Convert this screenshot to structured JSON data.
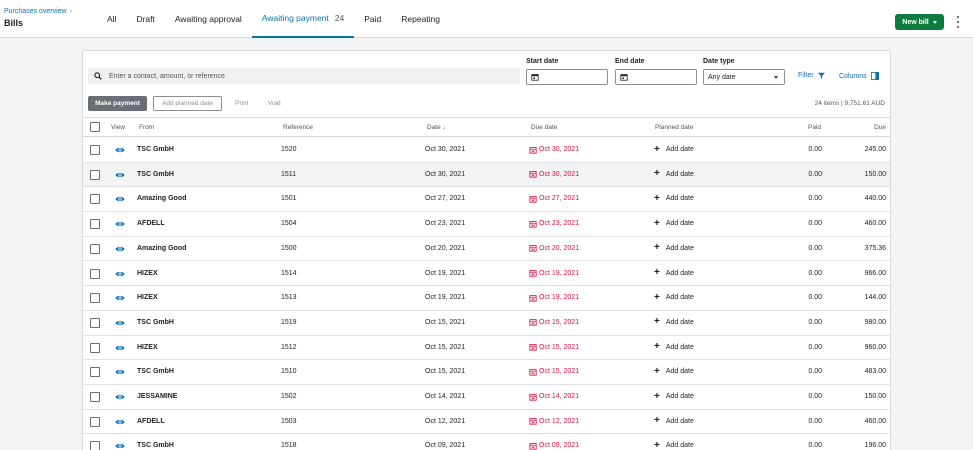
{
  "header": {
    "breadcrumb": "Purchases overview",
    "breadcrumb_chevron": "›",
    "title": "Bills",
    "new_bill_label": "New bill"
  },
  "tabs": [
    {
      "label": "All",
      "count": ""
    },
    {
      "label": "Draft",
      "count": ""
    },
    {
      "label": "Awaiting approval",
      "count": ""
    },
    {
      "label": "Awaiting payment",
      "count": "24",
      "active": true
    },
    {
      "label": "Paid",
      "count": ""
    },
    {
      "label": "Repeating",
      "count": ""
    }
  ],
  "filters": {
    "search_placeholder": "Enter a contact, amount, or reference",
    "start_date_label": "Start date",
    "end_date_label": "End date",
    "date_type_label": "Date type",
    "date_type_value": "Any date",
    "filter_label": "Filter",
    "columns_label": "Columns"
  },
  "actions": {
    "make_payment": "Make payment",
    "add_planned_date": "Add planned date",
    "print": "Print",
    "void": "Void",
    "summary": "24 items | 9,751.61 AUD"
  },
  "table": {
    "headers": {
      "view": "View",
      "from": "From",
      "reference": "Reference",
      "date": "Date",
      "date_sort": "↓",
      "due_date": "Due date",
      "planned_date": "Planned date",
      "paid": "Paid",
      "due": "Due"
    },
    "add_date_label": "Add date",
    "rows": [
      {
        "from": "TSC GmbH",
        "reference": "1520",
        "date": "Oct 30, 2021",
        "due_date": "Oct 30, 2021",
        "paid": "0.00",
        "due": "245.00"
      },
      {
        "from": "TSC GmbH",
        "reference": "1511",
        "date": "Oct 30, 2021",
        "due_date": "Oct 30, 2021",
        "paid": "0.00",
        "due": "150.00"
      },
      {
        "from": "Amazing Good",
        "reference": "1501",
        "date": "Oct 27, 2021",
        "due_date": "Oct 27, 2021",
        "paid": "0.00",
        "due": "440.00"
      },
      {
        "from": "AFDELL",
        "reference": "1504",
        "date": "Oct 23, 2021",
        "due_date": "Oct 23, 2021",
        "paid": "0.00",
        "due": "460.00"
      },
      {
        "from": "Amazing Good",
        "reference": "1500",
        "date": "Oct 20, 2021",
        "due_date": "Oct 20, 2021",
        "paid": "0.00",
        "due": "375.36"
      },
      {
        "from": "HIZEX",
        "reference": "1514",
        "date": "Oct 19, 2021",
        "due_date": "Oct 19, 2021",
        "paid": "0.00",
        "due": "966.00"
      },
      {
        "from": "HIZEX",
        "reference": "1513",
        "date": "Oct 19, 2021",
        "due_date": "Oct 19, 2021",
        "paid": "0.00",
        "due": "144.00"
      },
      {
        "from": "TSC GmbH",
        "reference": "1519",
        "date": "Oct 15, 2021",
        "due_date": "Oct 15, 2021",
        "paid": "0.00",
        "due": "980.00"
      },
      {
        "from": "HIZEX",
        "reference": "1512",
        "date": "Oct 15, 2021",
        "due_date": "Oct 15, 2021",
        "paid": "0.00",
        "due": "960.00"
      },
      {
        "from": "TSC GmbH",
        "reference": "1510",
        "date": "Oct 15, 2021",
        "due_date": "Oct 15, 2021",
        "paid": "0.00",
        "due": "483.00"
      },
      {
        "from": "JESSAMINE",
        "reference": "1502",
        "date": "Oct 14, 2021",
        "due_date": "Oct 14, 2021",
        "paid": "0.00",
        "due": "150.00"
      },
      {
        "from": "AFDELL",
        "reference": "1503",
        "date": "Oct 12, 2021",
        "due_date": "Oct 12, 2021",
        "paid": "0.00",
        "due": "460.00"
      },
      {
        "from": "TSC GmbH",
        "reference": "1518",
        "date": "Oct 09, 2021",
        "due_date": "Oct 09, 2021",
        "paid": "0.00",
        "due": "196.00"
      }
    ]
  },
  "colors": {
    "accent": "#0c6fad",
    "primary_button": "#0f7b3f",
    "overdue": "#de0e40"
  }
}
